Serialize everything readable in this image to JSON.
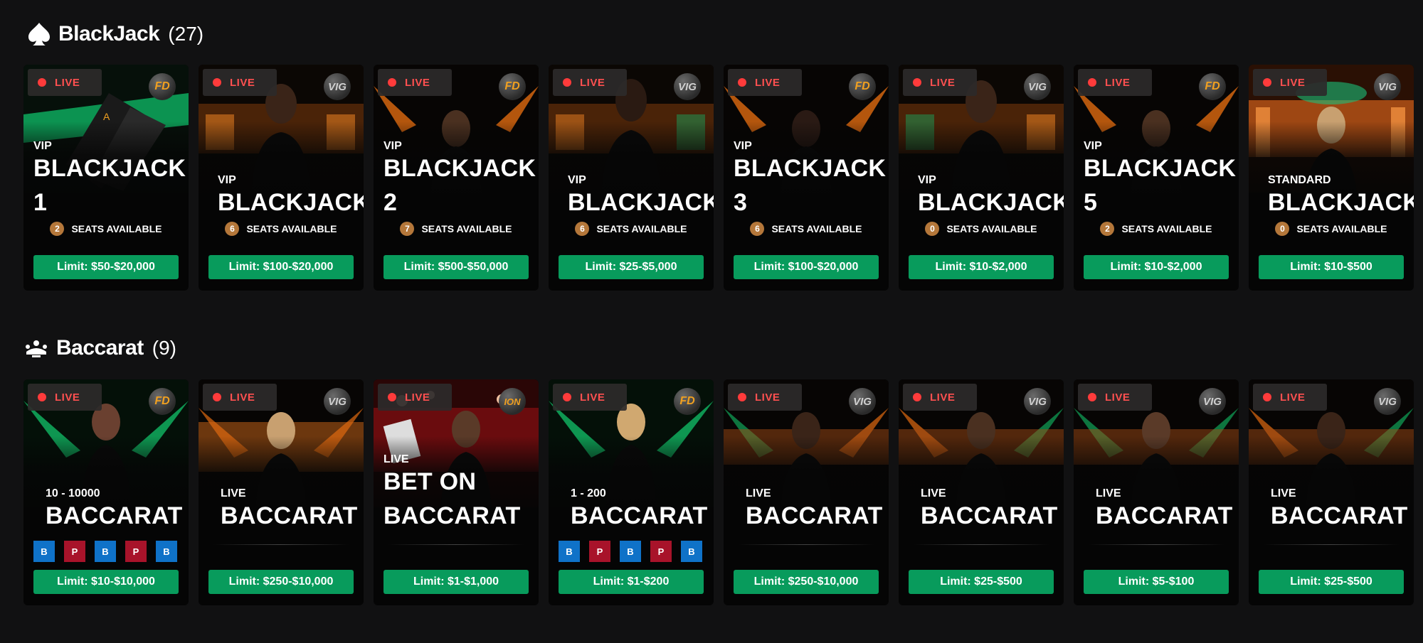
{
  "blackjack": {
    "title": "BlackJack",
    "count": "(27)",
    "tables": [
      {
        "live": "LIVE",
        "provider": "FD",
        "category": "VIP",
        "name": [
          "BLACKJACK",
          "1"
        ],
        "seats": "2",
        "seats_label": "SEATS AVAILABLE",
        "limit": "Limit: $50-$20,000"
      },
      {
        "live": "LIVE",
        "provider": "VIG",
        "category": "VIP",
        "name": [
          "BLACKJACK"
        ],
        "seats": "6",
        "seats_label": "SEATS AVAILABLE",
        "limit": "Limit: $100-$20,000"
      },
      {
        "live": "LIVE",
        "provider": "FD",
        "category": "VIP",
        "name": [
          "BLACKJACK",
          "2"
        ],
        "seats": "7",
        "seats_label": "SEATS AVAILABLE",
        "limit": "Limit: $500-$50,000"
      },
      {
        "live": "LIVE",
        "provider": "VIG",
        "category": "VIP",
        "name": [
          "BLACKJACK"
        ],
        "seats": "6",
        "seats_label": "SEATS AVAILABLE",
        "limit": "Limit: $25-$5,000"
      },
      {
        "live": "LIVE",
        "provider": "FD",
        "category": "VIP",
        "name": [
          "BLACKJACK",
          "3"
        ],
        "seats": "6",
        "seats_label": "SEATS AVAILABLE",
        "limit": "Limit: $100-$20,000"
      },
      {
        "live": "LIVE",
        "provider": "VIG",
        "category": "VIP",
        "name": [
          "BLACKJACK"
        ],
        "seats": "0",
        "seats_label": "SEATS AVAILABLE",
        "limit": "Limit: $10-$2,000"
      },
      {
        "live": "LIVE",
        "provider": "FD",
        "category": "VIP",
        "name": [
          "BLACKJACK",
          "5"
        ],
        "seats": "2",
        "seats_label": "SEATS AVAILABLE",
        "limit": "Limit: $10-$2,000"
      },
      {
        "live": "LIVE",
        "provider": "VIG",
        "category": "STANDARD",
        "name": [
          "BLACKJACK"
        ],
        "seats": "0",
        "seats_label": "SEATS AVAILABLE",
        "limit": "Limit: $10-$500"
      }
    ]
  },
  "baccarat": {
    "title": "Baccarat",
    "count": "(9)",
    "tables": [
      {
        "live": "LIVE",
        "provider": "FD",
        "category": "10 - 10000",
        "name": [
          "BACCARAT"
        ],
        "road": [
          "B",
          "P",
          "B",
          "P",
          "B"
        ],
        "limit": "Limit: $10-$10,000"
      },
      {
        "live": "LIVE",
        "provider": "VIG",
        "category": "LIVE",
        "name": [
          "BACCARAT"
        ],
        "limit": "Limit: $250-$10,000"
      },
      {
        "live": "LIVE",
        "provider": "ION",
        "category": "LIVE",
        "name": [
          "BET ON",
          "BACCARAT"
        ],
        "limit": "Limit: $1-$1,000"
      },
      {
        "live": "LIVE",
        "provider": "FD",
        "category": "1 - 200",
        "name": [
          "BACCARAT"
        ],
        "road": [
          "B",
          "P",
          "B",
          "P",
          "B"
        ],
        "limit": "Limit: $1-$200"
      },
      {
        "live": "LIVE",
        "provider": "VIG",
        "category": "LIVE",
        "name": [
          "BACCARAT"
        ],
        "limit": "Limit: $250-$10,000"
      },
      {
        "live": "LIVE",
        "provider": "VIG",
        "category": "LIVE",
        "name": [
          "BACCARAT"
        ],
        "limit": "Limit: $25-$500"
      },
      {
        "live": "LIVE",
        "provider": "VIG",
        "category": "LIVE",
        "name": [
          "BACCARAT"
        ],
        "limit": "Limit: $5-$100"
      },
      {
        "live": "LIVE",
        "provider": "VIG",
        "category": "LIVE",
        "name": [
          "BACCARAT"
        ],
        "limit": "Limit: $25-$500"
      }
    ]
  },
  "icons": {
    "blackjack": "spade-icon",
    "baccarat": "baccarat-table-icon"
  },
  "colors": {
    "background": "#111112",
    "live": "#ff3b3b",
    "limit_button": "#089b5c",
    "seat_badge": "#b4773a",
    "road_banker": "#0f72c8",
    "road_player": "#a8132a",
    "provider_fd": "#f0a020"
  }
}
